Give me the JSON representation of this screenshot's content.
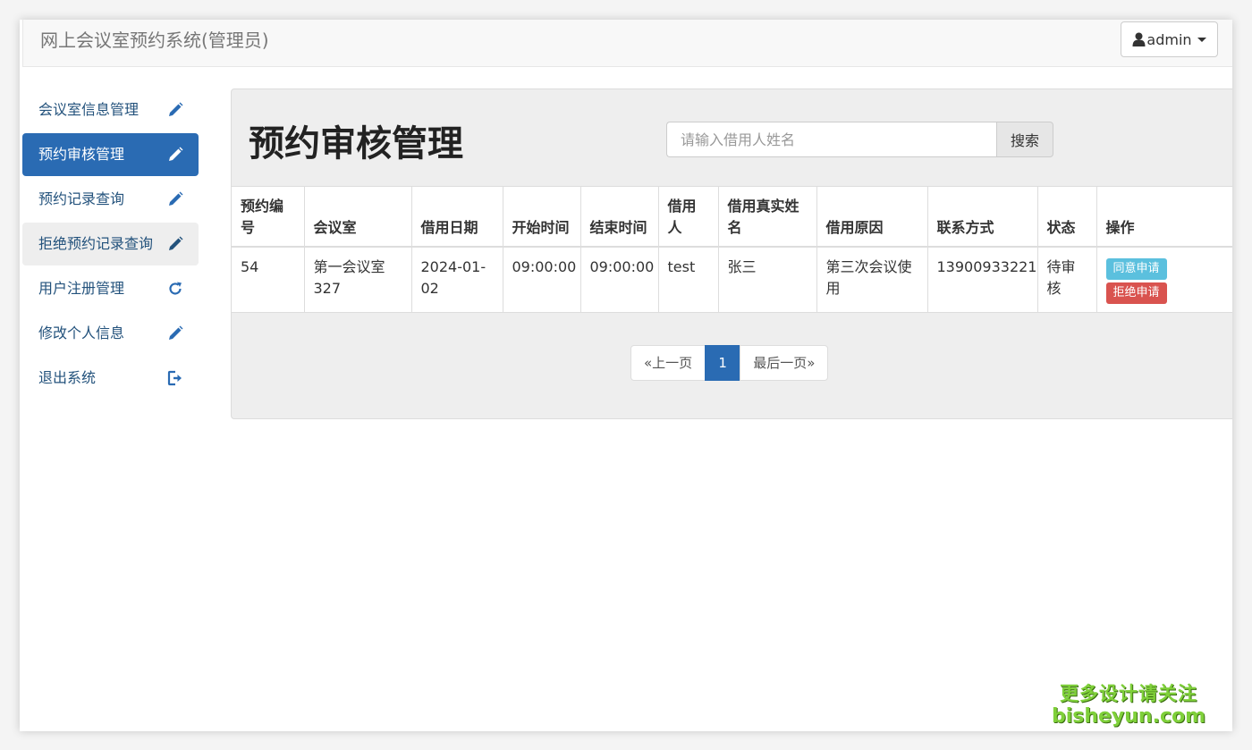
{
  "navbar": {
    "brand": "网上会议室预约系统(管理员)",
    "user_label": "admin"
  },
  "sidebar": {
    "items": [
      {
        "label": "会议室信息管理",
        "icon": "pencil-icon"
      },
      {
        "label": "预约审核管理",
        "icon": "pencil-icon",
        "active": true
      },
      {
        "label": "预约记录查询",
        "icon": "pencil-icon"
      },
      {
        "label": "拒绝预约记录查询",
        "icon": "pencil-icon"
      },
      {
        "label": "用户注册管理",
        "icon": "refresh-icon"
      },
      {
        "label": "修改个人信息",
        "icon": "pencil-icon"
      },
      {
        "label": "退出系统",
        "icon": "logout-icon"
      }
    ]
  },
  "main": {
    "title": "预约审核管理",
    "search": {
      "placeholder": "请输入借用人姓名",
      "button_label": "搜索"
    },
    "table": {
      "headers": [
        "预约编号",
        "会议室",
        "借用日期",
        "开始时间",
        "结束时间",
        "借用人",
        "借用真实姓名",
        "借用原因",
        "联系方式",
        "状态",
        "操作"
      ],
      "rows": [
        {
          "id": "54",
          "room": "第一会议室327",
          "date": "2024-01-02",
          "start": "09:00:00",
          "end": "09:00:00",
          "user": "test",
          "real_name": "张三",
          "reason": "第三次会议使用",
          "phone": "13900933221",
          "status": "待审核",
          "approve_label": "同意申请",
          "reject_label": "拒绝申请"
        }
      ]
    },
    "pagination": {
      "prev": "«上一页",
      "current": "1",
      "last": "最后一页»"
    }
  },
  "watermark": {
    "line1": "更多设计请关注",
    "line2": "bisheyun.com"
  },
  "colors": {
    "primary": "#2a6bb3",
    "link": "#23527c",
    "info": "#5bc0de",
    "danger": "#d9534f"
  }
}
